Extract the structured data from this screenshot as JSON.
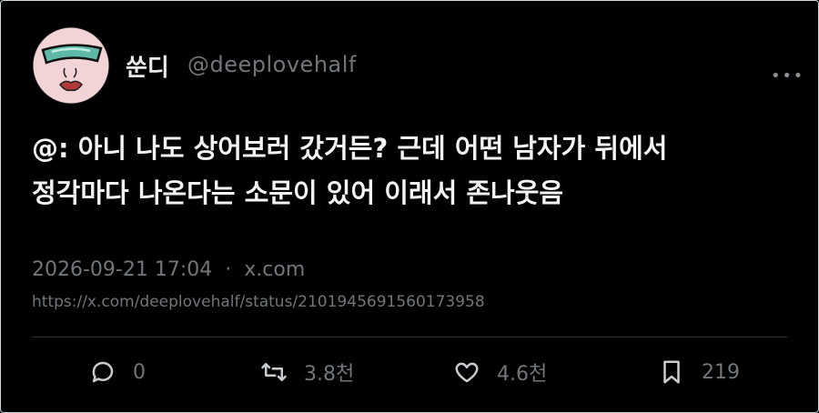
{
  "author": {
    "display_name": "쑨디",
    "handle": "@deeplovehalf"
  },
  "tweet": {
    "text_line1": "@: 아니 나도 상어보러 갔거든? 근데 어떤 남자가 뒤에서",
    "text_line2": "정각마다 나온다는 소문이 있어 이래서 존나웃음"
  },
  "meta": {
    "timestamp": "2026-09-21 17:04",
    "separator": "·",
    "source": "x.com"
  },
  "url": "https://x.com/deeplovehalf/status/2101945691560173958",
  "actions": {
    "replies": "0",
    "retweets": "3.8천",
    "likes": "4.6천",
    "bookmarks": "219"
  },
  "icons": {
    "more": "more-horizontal-icon",
    "reply": "reply-icon",
    "retweet": "retweet-icon",
    "like": "heart-icon",
    "bookmark": "bookmark-icon"
  }
}
